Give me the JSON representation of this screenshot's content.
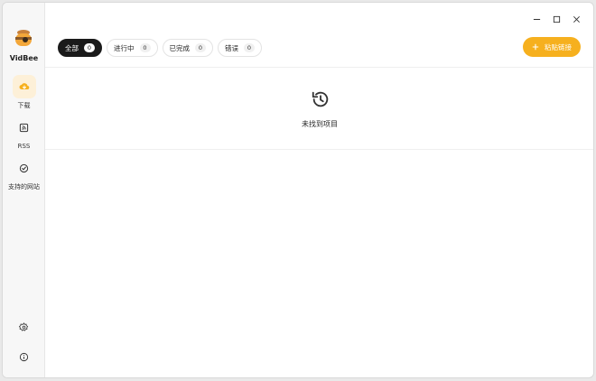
{
  "app": {
    "name": "VidBee"
  },
  "sidebar": {
    "items": [
      {
        "label": "下载",
        "icon": "cloud-download-icon",
        "active": true
      },
      {
        "label": "RSS",
        "icon": "rss-icon",
        "active": false
      },
      {
        "label": "支持的网站",
        "icon": "check-circle-icon",
        "active": false
      }
    ],
    "bottom": [
      {
        "icon": "gear-icon"
      },
      {
        "icon": "info-icon"
      }
    ]
  },
  "filters": [
    {
      "label": "全部",
      "count": "0",
      "active": true
    },
    {
      "label": "进行中",
      "count": "0",
      "active": false
    },
    {
      "label": "已完成",
      "count": "0",
      "active": false
    },
    {
      "label": "错误",
      "count": "0",
      "active": false
    }
  ],
  "toolbar": {
    "paste_label": "粘贴链接",
    "paste_icon": "plus-icon"
  },
  "empty_state": {
    "message": "未找到项目",
    "icon": "history-icon"
  },
  "colors": {
    "accent": "#f6b01e",
    "active_chip": "#1a1a1a",
    "active_nav_bg": "#fdf0d8"
  }
}
